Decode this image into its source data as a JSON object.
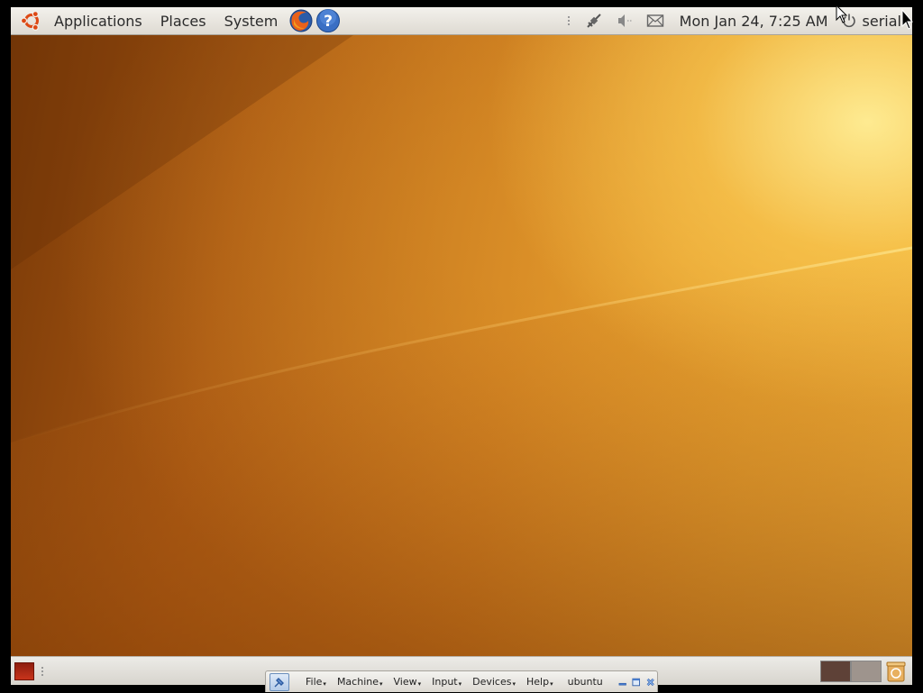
{
  "top_panel": {
    "menus": [
      {
        "label": "Applications"
      },
      {
        "label": "Places"
      },
      {
        "label": "System"
      }
    ],
    "launchers": [
      "firefox-icon",
      "help-icon"
    ],
    "tray_icons": [
      "network-icon",
      "volume-muted-icon",
      "mail-icon"
    ],
    "clock": "Mon Jan 24,  7:25 AM",
    "user": "serial"
  },
  "bottom_panel": {
    "workspaces": 2
  },
  "vbox_toolbar": {
    "menus": [
      "File",
      "Machine",
      "View",
      "Input",
      "Devices",
      "Help"
    ],
    "vm_name": "ubuntu",
    "buttons": [
      "minimize-icon",
      "restore-icon",
      "close-icon"
    ]
  },
  "colors": {
    "panel": "#dedad2",
    "wallpaper_dark": "#7a3a08",
    "wallpaper_light": "#eeb43c",
    "ubuntu_orange": "#dd4814"
  }
}
